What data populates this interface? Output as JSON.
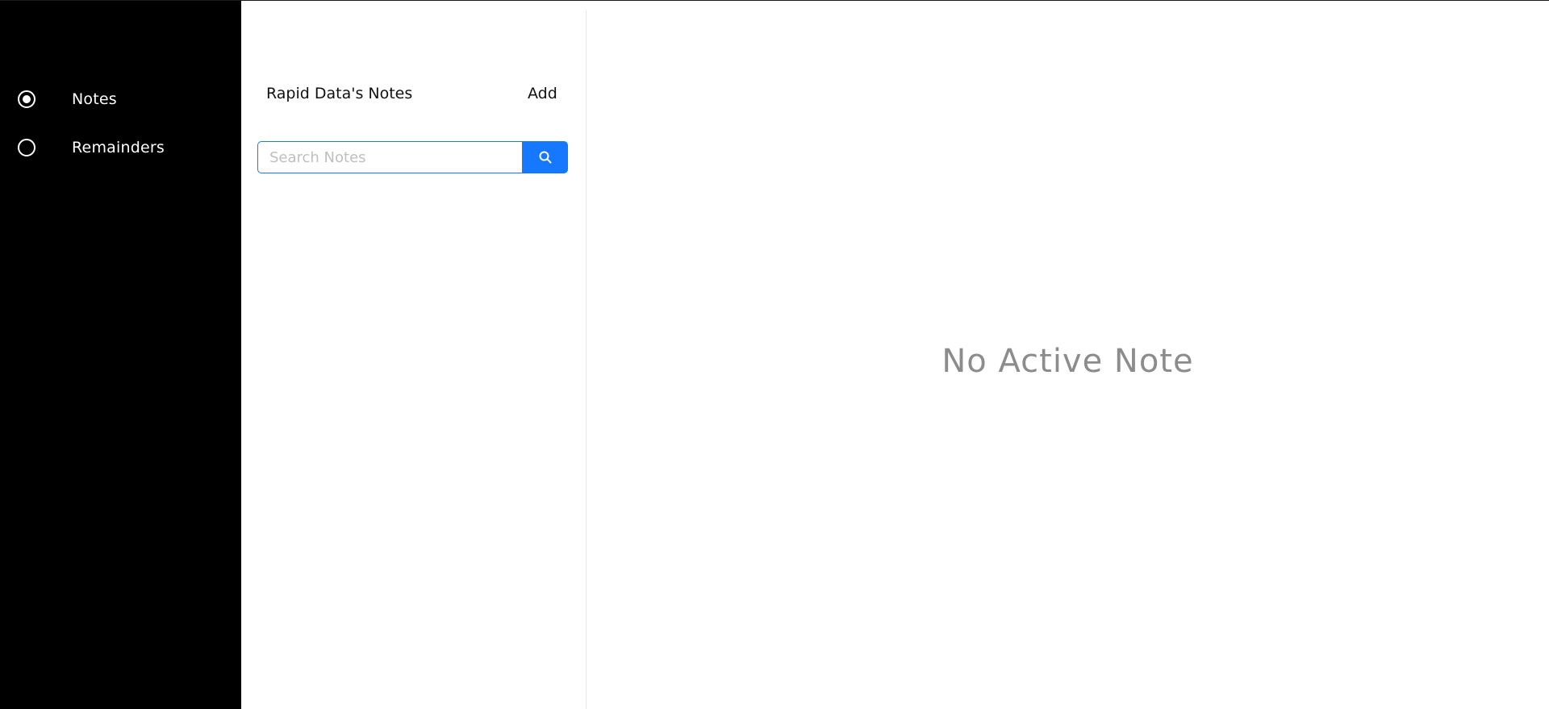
{
  "sidebar": {
    "items": [
      {
        "label": "Notes",
        "selected": true
      },
      {
        "label": "Remainders",
        "selected": false
      }
    ]
  },
  "notes_list": {
    "title": "Rapid Data's Notes",
    "add_label": "Add",
    "search": {
      "placeholder": "Search Notes",
      "value": ""
    }
  },
  "main": {
    "empty_message": "No Active Note"
  },
  "colors": {
    "sidebar_bg": "#000000",
    "accent": "#1677ff",
    "empty_text": "#8c8c8c"
  },
  "icons": {
    "search_button": "search-icon",
    "notes_radio": "radio-checked-icon",
    "remainders_radio": "radio-unchecked-icon"
  }
}
